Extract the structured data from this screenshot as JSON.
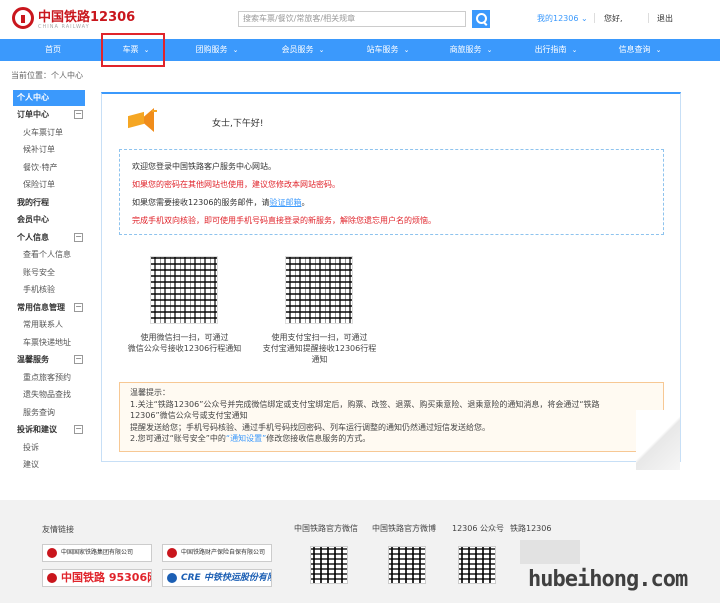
{
  "header": {
    "logo_name": "中国铁路12306",
    "logo_sub": "CHINA RAILWAY",
    "search_placeholder": "搜索车票/餐饮/常旅客/相关规章",
    "my_account": "我的12306 ⌄",
    "greeting": "您好,",
    "logout": "退出"
  },
  "nav": {
    "items": [
      {
        "label": "首页"
      },
      {
        "label": "车票"
      },
      {
        "label": "团购服务"
      },
      {
        "label": "会员服务"
      },
      {
        "label": "站车服务"
      },
      {
        "label": "商旅服务"
      },
      {
        "label": "出行指南"
      },
      {
        "label": "信息查询"
      }
    ],
    "chevron": "⌄",
    "highlighted": "车票"
  },
  "breadcrumb": "当前位置：个人中心",
  "sidebar": {
    "head": "个人中心",
    "sections": [
      {
        "title": "订单中心",
        "toggle": "−",
        "items": [
          "火车票订单",
          "候补订单",
          "餐饮·特产",
          "保险订单"
        ]
      },
      {
        "title": "我的行程",
        "toggle": "",
        "items": []
      },
      {
        "title": "会员中心",
        "toggle": "",
        "items": []
      },
      {
        "title": "个人信息",
        "toggle": "−",
        "items": [
          "查看个人信息",
          "账号安全",
          "手机核验"
        ]
      },
      {
        "title": "常用信息管理",
        "toggle": "−",
        "items": [
          "常用联系人",
          "车票快递地址"
        ]
      },
      {
        "title": "温馨服务",
        "toggle": "−",
        "items": [
          "重点旅客预约",
          "遗失物品查找",
          "服务查询"
        ]
      },
      {
        "title": "投诉和建议",
        "toggle": "−",
        "items": [
          "投诉",
          "建议"
        ]
      }
    ]
  },
  "main": {
    "greeting": "女士,下午好!",
    "welcome_lines": [
      {
        "text": "欢迎您登录中国铁路客户服务中心网站。",
        "red": false
      },
      {
        "text": "如果您的密码在其他网站也使用，建议您修改本网站密码。",
        "red": true
      },
      {
        "text_before": "如果您需要接收12306的服务邮件，请",
        "link": "验证邮箱",
        "text_after": "。",
        "red": false
      },
      {
        "text": "完成手机双向核验，即可使用手机号码直接登录的新服务，解除您遗忘用户名的烦恼。",
        "red": true
      }
    ],
    "qr_captions": [
      [
        "使用微信扫一扫，可通过",
        "微信公众号接收12306行程通知"
      ],
      [
        "使用支付宝扫一扫，可通过",
        "支付宝通知提醒接收12306行程",
        "通知"
      ]
    ],
    "tips": {
      "title": "温馨提示：",
      "line1": "1.关注“铁路12306”公众号并完成微信绑定或支付宝绑定后，购票、改签、退票、购买乘意险、退乘意险的通知消息，将会通过“铁路",
      "line2": "12306”微信公众号或支付宝通知",
      "line3": "提醒发送给您；手机号码核验、通过手机号码找回密码、列车运行调整的通知仍然通过短信发送给您。",
      "line4_before": "2.您可通过“账号安全”中的",
      "line4_link": "“通知设置”",
      "line4_after": "修改您接收信息服务的方式。"
    }
  },
  "footer": {
    "links_title": "友情链接",
    "partners": [
      {
        "name": "中国国家铁路集团有限公司",
        "sub": "CHINA RAILWAY"
      },
      {
        "name": "中国铁路财产保险自保有限公司",
        "sub": ""
      },
      {
        "name": "中国铁路 95306网",
        "sub": ""
      },
      {
        "name": "CRE 中铁快运股份有限公司",
        "sub": ""
      }
    ],
    "cols": [
      "中国铁路官方微信",
      "中国铁路官方微博",
      "12306 公众号",
      "铁路12306"
    ]
  },
  "watermark": "hubeihong.com"
}
